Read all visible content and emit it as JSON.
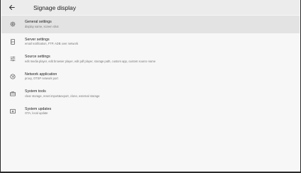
{
  "appbar": {
    "title": "Signage display",
    "back_icon": "arrow-left-icon"
  },
  "items": [
    {
      "title": "General settings",
      "subtitle": "display name, screen shot",
      "icon": "gear-icon",
      "selected": true
    },
    {
      "title": "Server settings",
      "subtitle": "email notification, FTP, ADB over network",
      "icon": "server-icon",
      "selected": false
    },
    {
      "title": "Source settings",
      "subtitle": "edit media player, edit browser player, edit pdf player, storage path, custom app, custom source name",
      "icon": "tune-icon",
      "selected": false
    },
    {
      "title": "Network application",
      "subtitle": "proxy, OTSP network port",
      "icon": "network-icon",
      "selected": false
    },
    {
      "title": "System tools",
      "subtitle": "clear storage, reset import&export, clone, external storage",
      "icon": "toolbox-icon",
      "selected": false
    },
    {
      "title": "System updates",
      "subtitle": "OTA, local update",
      "icon": "update-icon",
      "selected": false
    }
  ]
}
